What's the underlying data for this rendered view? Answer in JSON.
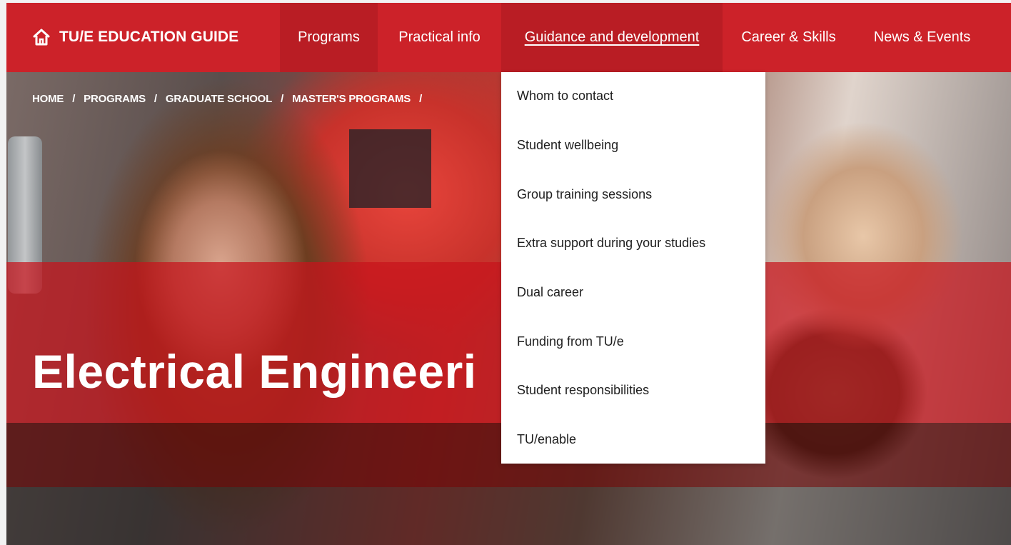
{
  "header": {
    "brand": "TU/E EDUCATION GUIDE",
    "brand_icon": "home-icon",
    "accent_color": "#cc2229",
    "nav": [
      {
        "label": "Programs"
      },
      {
        "label": "Practical info"
      },
      {
        "label": "Guidance and development",
        "active": true
      },
      {
        "label": "Career & Skills"
      },
      {
        "label": "News & Events"
      }
    ]
  },
  "breadcrumb": [
    "HOME",
    "PROGRAMS",
    "GRADUATE SCHOOL",
    "MASTER'S PROGRAMS"
  ],
  "breadcrumb_separator": "/",
  "page_title": "Electrical Engineeri",
  "dropdown": {
    "items": [
      "Whom to contact",
      "Student wellbeing",
      "Group training sessions",
      "Extra support during your studies",
      "Dual career",
      "Funding from TU/e",
      "Student responsibilities",
      "TU/enable"
    ]
  }
}
